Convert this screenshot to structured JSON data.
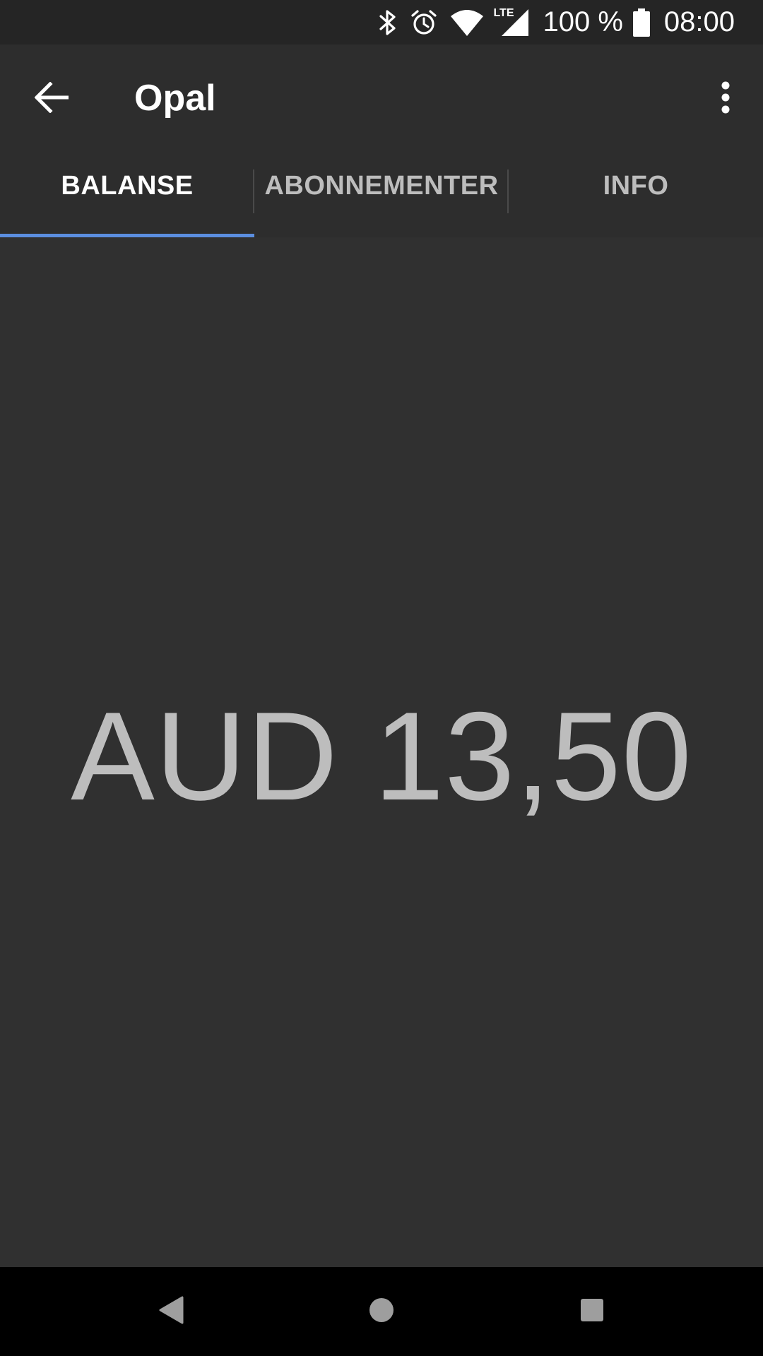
{
  "status_bar": {
    "icons": [
      "bluetooth-icon",
      "alarm-icon",
      "wifi-icon",
      "lte-signal-icon"
    ],
    "lte_label": "LTE",
    "battery_percent": "100 %",
    "battery_icon": "battery-full-icon",
    "time": "08:00"
  },
  "app_bar": {
    "back_icon": "arrow-back-icon",
    "title": "Opal",
    "overflow_icon": "more-vert-icon"
  },
  "tabs": [
    {
      "label": "BALANSE",
      "active": true
    },
    {
      "label": "ABONNEMENTER",
      "active": false
    },
    {
      "label": "INFO",
      "active": false
    }
  ],
  "balance": {
    "text": "AUD 13,50"
  },
  "nav_bar": {
    "back_icon": "nav-back-icon",
    "home_icon": "nav-home-icon",
    "recents_icon": "nav-recents-icon"
  },
  "colors": {
    "background": "#303030",
    "app_bar": "#2d2d2d",
    "status_bar": "#252525",
    "accent": "#5b8ee0",
    "balance_text": "#bdbdbd"
  }
}
